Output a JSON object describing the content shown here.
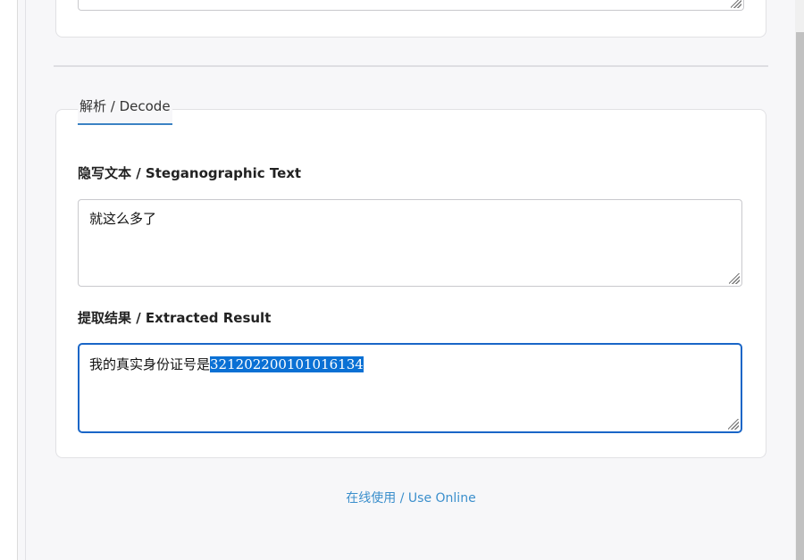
{
  "decode_section": {
    "tab_label": "解析 / Decode"
  },
  "steganographic_text": {
    "label": "隐写文本 / Steganographic Text",
    "value": "就这么多了"
  },
  "extracted_result": {
    "label": "提取结果 / Extracted Result",
    "value_prefix": "我的真实身份证号是",
    "value_selected": "321202200101016134"
  },
  "footer": {
    "link_label": "在线使用 / Use Online"
  },
  "colors": {
    "accent": "#3b82c4",
    "focus_border": "#1a66c7",
    "selection": "#0a70d4",
    "link": "#3b8fcc"
  }
}
